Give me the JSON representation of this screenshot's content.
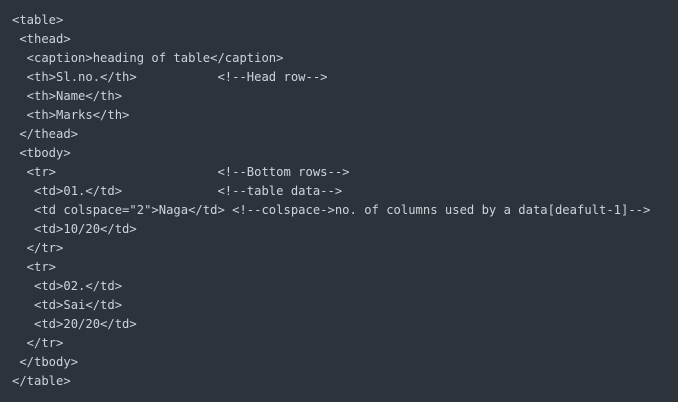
{
  "code": {
    "lines": [
      "<table>",
      " <thead>",
      "  <caption>heading of table</caption>",
      "  <th>Sl.no.</th>           <!--Head row-->",
      "  <th>Name</th>",
      "  <th>Marks</th>",
      " </thead>",
      " <tbody>",
      "  <tr>                      <!--Bottom rows-->",
      "   <td>01.</td>             <!--table data-->",
      "   <td colspace=\"2\">Naga</td> <!--colspace->no. of columns used by a data[deafult-1]-->",
      "   <td>10/20</td>",
      "  </tr>",
      "  <tr>",
      "   <td>02.</td>",
      "   <td>Sai</td>",
      "   <td>20/20</td>",
      "  </tr>",
      " </tbody>",
      "</table>"
    ]
  },
  "colors": {
    "background": "#2d333b",
    "text": "#cdd3da"
  }
}
